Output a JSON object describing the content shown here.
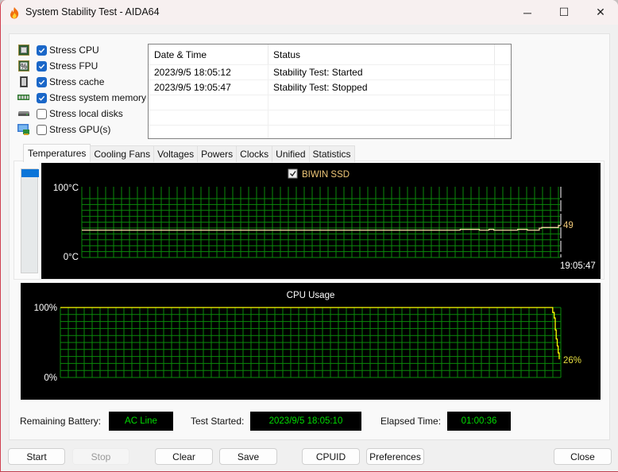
{
  "window": {
    "title": "System Stability Test - AIDA64",
    "icon": "flame-icon",
    "controls": {
      "minimize": "─",
      "maximize": "☐",
      "close": "✕"
    }
  },
  "stress_options": [
    {
      "label": "Stress CPU",
      "icon": "cpu-chip-icon",
      "checked": true
    },
    {
      "label": "Stress FPU",
      "icon": "fpu-percent-icon",
      "checked": true
    },
    {
      "label": "Stress cache",
      "icon": "cache-chip-icon",
      "checked": true
    },
    {
      "label": "Stress system memory",
      "icon": "memory-module-icon",
      "checked": true
    },
    {
      "label": "Stress local disks",
      "icon": "disk-drive-icon",
      "checked": false
    },
    {
      "label": "Stress GPU(s)",
      "icon": "gpu-monitor-icon",
      "checked": false
    }
  ],
  "log": {
    "columns": [
      "Date & Time",
      "Status"
    ],
    "rows": [
      [
        "2023/9/5 18:05:12",
        "Stability Test: Started"
      ],
      [
        "2023/9/5 19:05:47",
        "Stability Test: Stopped"
      ],
      [
        "",
        ""
      ],
      [
        "",
        ""
      ],
      [
        "",
        ""
      ]
    ]
  },
  "tabs": [
    {
      "label": "Temperatures",
      "active": true
    },
    {
      "label": "Cooling Fans",
      "active": false
    },
    {
      "label": "Voltages",
      "active": false
    },
    {
      "label": "Powers",
      "active": false
    },
    {
      "label": "Clocks",
      "active": false
    },
    {
      "label": "Unified",
      "active": false
    },
    {
      "label": "Statistics",
      "active": false
    }
  ],
  "chart_data": [
    {
      "type": "line",
      "title": "BIWIN SSD",
      "legend_checked": true,
      "series_color": "#f0d8a0",
      "ylabel_top": "100°C",
      "ylabel_bottom": "0°C",
      "ylim": [
        0,
        100
      ],
      "grid": true,
      "current_value_label": "49",
      "time_label": "19:05:47",
      "x": [
        0,
        0.78,
        0.79,
        0.82,
        0.83,
        0.85,
        0.86,
        0.9,
        0.91,
        0.93,
        0.94,
        0.955,
        0.96,
        0.99,
        0.995,
        1.0
      ],
      "values": [
        42,
        42,
        43,
        43,
        42,
        43,
        42,
        42,
        43,
        42,
        42,
        45,
        46,
        46,
        49,
        49
      ]
    },
    {
      "type": "line",
      "title": "CPU Usage",
      "series_color": "#ffff00",
      "ylabel_top": "100%",
      "ylabel_bottom": "0%",
      "ylim": [
        0,
        100
      ],
      "grid": true,
      "current_value_label": "26%",
      "x": [
        0,
        0.985,
        0.987,
        0.99,
        0.992,
        0.994,
        0.996,
        0.998,
        1.0
      ],
      "values": [
        100,
        100,
        93,
        85,
        68,
        55,
        45,
        35,
        26
      ]
    }
  ],
  "status": {
    "battery_label": "Remaining Battery:",
    "battery_value": "AC Line",
    "started_label": "Test Started:",
    "started_value": "2023/9/5 18:05:10",
    "elapsed_label": "Elapsed Time:",
    "elapsed_value": "01:00:36",
    "value_color": "#00dd00"
  },
  "buttons": {
    "start": "Start",
    "stop": "Stop",
    "clear": "Clear",
    "save": "Save",
    "cpuid": "CPUID",
    "preferences": "Preferences",
    "close": "Close"
  }
}
